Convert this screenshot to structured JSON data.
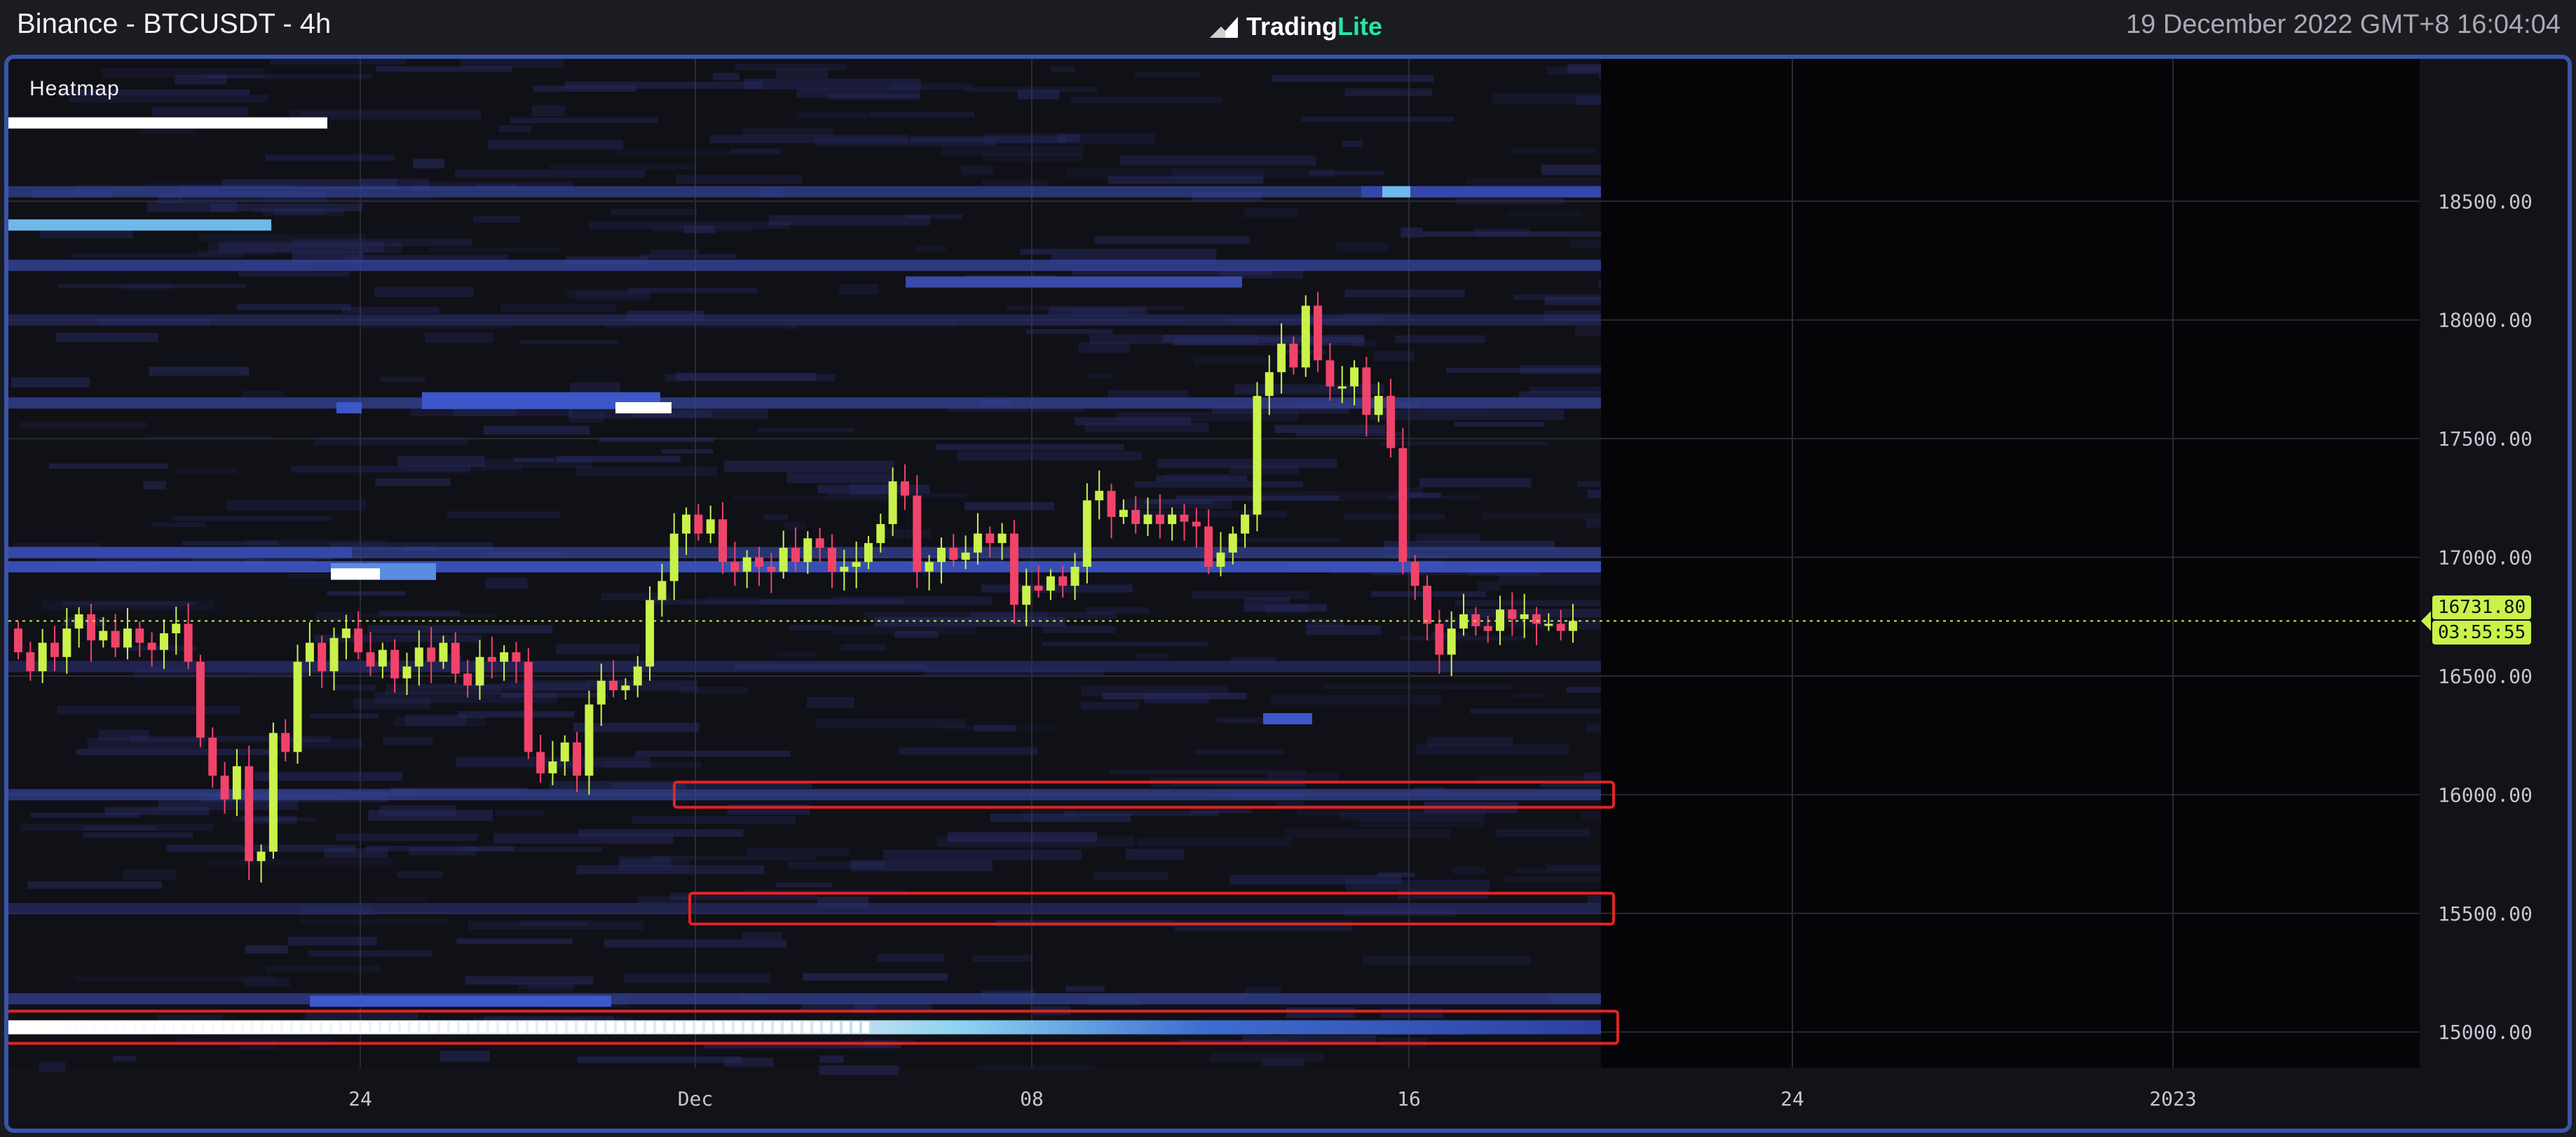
{
  "header": {
    "title": "Binance - BTCUSDT - 4h",
    "brand_primary": "Trading",
    "brand_accent": "Lite",
    "datetime": "19 December 2022 GMT+8 16:04:04"
  },
  "chart": {
    "indicator_label": "Heatmap",
    "current_price": "16731.80",
    "countdown": "03:55:55",
    "colors": {
      "bull": "#c9f24b",
      "bear": "#f0436a",
      "heat_low": "#2a2e6a",
      "heat_mid": "#3e5bd0",
      "heat_high": "#8ad2f0",
      "heat_max": "#ffffff",
      "highlight_box": "#e02424",
      "frame": "#3a54a8"
    }
  },
  "chart_data": {
    "type": "candlestick",
    "interval": "4h",
    "symbol": "BTCUSDT",
    "exchange": "Binance",
    "y_ticks": [
      "18500.00",
      "18000.00",
      "17500.00",
      "17000.00",
      "16500.00",
      "16000.00",
      "15500.00",
      "15000.00"
    ],
    "y_tick_values": [
      18500,
      18000,
      17500,
      17000,
      16500,
      16000,
      15500,
      15000
    ],
    "x_ticks": [
      "24",
      "Dec",
      "08",
      "16",
      "24",
      "2023"
    ],
    "ylim": [
      14850,
      19100
    ],
    "closes": [
      16600,
      16520,
      16640,
      16580,
      16700,
      16760,
      16650,
      16690,
      16620,
      16700,
      16640,
      16610,
      16680,
      16720,
      16560,
      16240,
      16080,
      15980,
      16120,
      15720,
      15760,
      16260,
      16180,
      16560,
      16640,
      16520,
      16660,
      16700,
      16600,
      16540,
      16610,
      16490,
      16540,
      16620,
      16560,
      16640,
      16510,
      16460,
      16580,
      16560,
      16600,
      16560,
      16180,
      16090,
      16140,
      16220,
      16080,
      16380,
      16480,
      16440,
      16460,
      16540,
      16820,
      16900,
      17100,
      17180,
      17100,
      17160,
      16980,
      16940,
      17000,
      16960,
      16940,
      17040,
      16980,
      17080,
      17040,
      16940,
      16960,
      16980,
      17060,
      17140,
      17320,
      17260,
      16940,
      16980,
      17040,
      16990,
      17020,
      17100,
      17060,
      17100,
      16800,
      16880,
      16860,
      16920,
      16880,
      16960,
      17240,
      17280,
      17170,
      17200,
      17140,
      17180,
      17140,
      17180,
      17150,
      17130,
      16960,
      17020,
      17100,
      17180,
      17680,
      17780,
      17900,
      17800,
      18060,
      17830,
      17720,
      17720,
      17800,
      17600,
      17680,
      17460,
      16980,
      16880,
      16720,
      16590,
      16700,
      16760,
      16710,
      16690,
      16780,
      16740,
      16760,
      16720,
      16720,
      16690,
      16731.8
    ],
    "heat_levels": [
      {
        "price": 18540,
        "intensity": 0.6
      },
      {
        "price": 18230,
        "intensity": 0.8
      },
      {
        "price": 18000,
        "intensity": 0.4
      },
      {
        "price": 17650,
        "intensity": 0.7
      },
      {
        "price": 17020,
        "intensity": 0.6
      },
      {
        "price": 16960,
        "intensity": 0.9
      },
      {
        "price": 16540,
        "intensity": 0.5
      },
      {
        "price": 16000,
        "intensity": 0.6
      },
      {
        "price": 15520,
        "intensity": 0.5
      },
      {
        "price": 15140,
        "intensity": 0.6
      },
      {
        "price": 15020,
        "intensity": 1.0
      }
    ],
    "highlighted_levels": [
      16000,
      15520,
      15020
    ]
  }
}
